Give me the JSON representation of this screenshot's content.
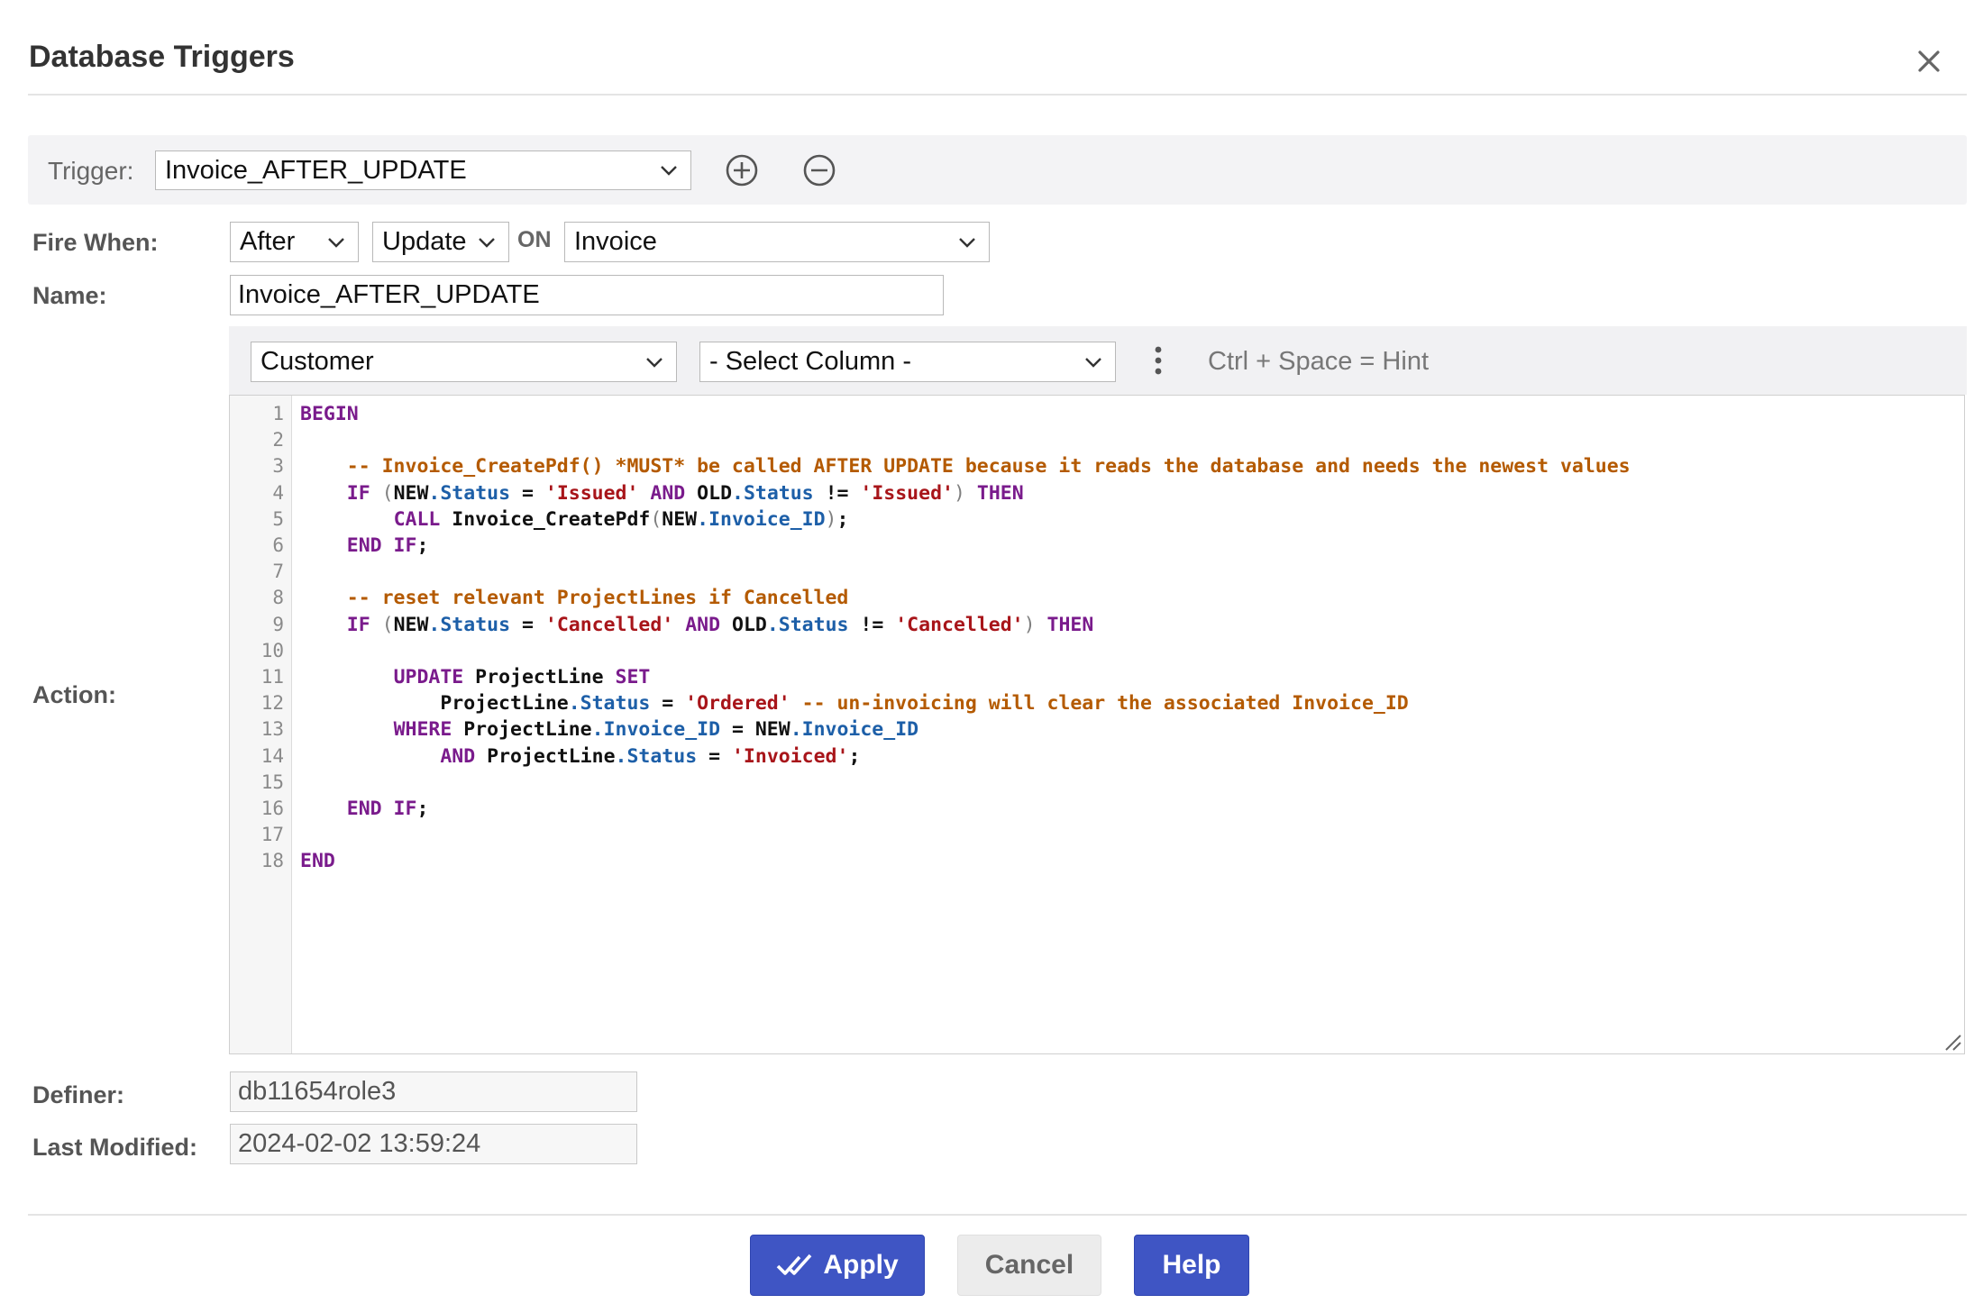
{
  "dialog": {
    "title": "Database Triggers"
  },
  "trigger": {
    "label": "Trigger:",
    "selected": "Invoice_AFTER_UPDATE"
  },
  "fire_when": {
    "label": "Fire When:",
    "timing": "After",
    "event": "Update",
    "on_label": "ON",
    "table": "Invoice"
  },
  "name": {
    "label": "Name:",
    "value": "Invoice_AFTER_UPDATE"
  },
  "action": {
    "label": "Action:",
    "table_select": "Customer",
    "column_select": "- Select Column -",
    "hint": "Ctrl + Space = Hint",
    "line_numbers": [
      "1",
      "2",
      "3",
      "4",
      "5",
      "6",
      "7",
      "8",
      "9",
      "10",
      "11",
      "12",
      "13",
      "14",
      "15",
      "16",
      "17",
      "18"
    ],
    "code_lines": [
      [
        {
          "t": "kw",
          "v": "BEGIN"
        }
      ],
      [],
      [
        {
          "t": "pl",
          "v": "    "
        },
        {
          "t": "cm",
          "v": "-- Invoice_CreatePdf() *MUST* be called AFTER UPDATE because it reads the database and needs the newest values"
        }
      ],
      [
        {
          "t": "pl",
          "v": "    "
        },
        {
          "t": "kw",
          "v": "IF"
        },
        {
          "t": "pl",
          "v": " "
        },
        {
          "t": "pn",
          "v": "("
        },
        {
          "t": "pl",
          "v": "NEW"
        },
        {
          "t": "fd",
          "v": ".Status"
        },
        {
          "t": "pl",
          "v": " = "
        },
        {
          "t": "st",
          "v": "'Issued'"
        },
        {
          "t": "pl",
          "v": " "
        },
        {
          "t": "kw",
          "v": "AND"
        },
        {
          "t": "pl",
          "v": " OLD"
        },
        {
          "t": "fd",
          "v": ".Status"
        },
        {
          "t": "pl",
          "v": " != "
        },
        {
          "t": "st",
          "v": "'Issued'"
        },
        {
          "t": "pn",
          "v": ")"
        },
        {
          "t": "pl",
          "v": " "
        },
        {
          "t": "kw",
          "v": "THEN"
        }
      ],
      [
        {
          "t": "pl",
          "v": "        "
        },
        {
          "t": "kw",
          "v": "CALL"
        },
        {
          "t": "pl",
          "v": " Invoice_CreatePdf"
        },
        {
          "t": "pn",
          "v": "("
        },
        {
          "t": "pl",
          "v": "NEW"
        },
        {
          "t": "fd",
          "v": ".Invoice_ID"
        },
        {
          "t": "pn",
          "v": ")"
        },
        {
          "t": "pl",
          "v": ";"
        }
      ],
      [
        {
          "t": "pl",
          "v": "    "
        },
        {
          "t": "kw",
          "v": "END IF"
        },
        {
          "t": "pl",
          "v": ";"
        }
      ],
      [],
      [
        {
          "t": "pl",
          "v": "    "
        },
        {
          "t": "cm",
          "v": "-- reset relevant ProjectLines if Cancelled"
        }
      ],
      [
        {
          "t": "pl",
          "v": "    "
        },
        {
          "t": "kw",
          "v": "IF"
        },
        {
          "t": "pl",
          "v": " "
        },
        {
          "t": "pn",
          "v": "("
        },
        {
          "t": "pl",
          "v": "NEW"
        },
        {
          "t": "fd",
          "v": ".Status"
        },
        {
          "t": "pl",
          "v": " = "
        },
        {
          "t": "st",
          "v": "'Cancelled'"
        },
        {
          "t": "pl",
          "v": " "
        },
        {
          "t": "kw",
          "v": "AND"
        },
        {
          "t": "pl",
          "v": " OLD"
        },
        {
          "t": "fd",
          "v": ".Status"
        },
        {
          "t": "pl",
          "v": " != "
        },
        {
          "t": "st",
          "v": "'Cancelled'"
        },
        {
          "t": "pn",
          "v": ")"
        },
        {
          "t": "pl",
          "v": " "
        },
        {
          "t": "kw",
          "v": "THEN"
        }
      ],
      [],
      [
        {
          "t": "pl",
          "v": "        "
        },
        {
          "t": "kw",
          "v": "UPDATE"
        },
        {
          "t": "pl",
          "v": " ProjectLine "
        },
        {
          "t": "kw",
          "v": "SET"
        }
      ],
      [
        {
          "t": "pl",
          "v": "            ProjectLine"
        },
        {
          "t": "fd",
          "v": ".Status"
        },
        {
          "t": "pl",
          "v": " = "
        },
        {
          "t": "st",
          "v": "'Ordered'"
        },
        {
          "t": "pl",
          "v": " "
        },
        {
          "t": "cm",
          "v": "-- un-invoicing will clear the associated Invoice_ID"
        }
      ],
      [
        {
          "t": "pl",
          "v": "        "
        },
        {
          "t": "kw",
          "v": "WHERE"
        },
        {
          "t": "pl",
          "v": " ProjectLine"
        },
        {
          "t": "fd",
          "v": ".Invoice_ID"
        },
        {
          "t": "pl",
          "v": " = NEW"
        },
        {
          "t": "fd",
          "v": ".Invoice_ID"
        }
      ],
      [
        {
          "t": "pl",
          "v": "            "
        },
        {
          "t": "kw",
          "v": "AND"
        },
        {
          "t": "pl",
          "v": " ProjectLine"
        },
        {
          "t": "fd",
          "v": ".Status"
        },
        {
          "t": "pl",
          "v": " = "
        },
        {
          "t": "st",
          "v": "'Invoiced'"
        },
        {
          "t": "pl",
          "v": ";"
        }
      ],
      [],
      [
        {
          "t": "pl",
          "v": "    "
        },
        {
          "t": "kw",
          "v": "END IF"
        },
        {
          "t": "pl",
          "v": ";"
        }
      ],
      [],
      [
        {
          "t": "kw",
          "v": "END"
        }
      ]
    ]
  },
  "definer": {
    "label": "Definer:",
    "value": "db11654role3"
  },
  "last_modified": {
    "label": "Last Modified:",
    "value": "2024-02-02 13:59:24"
  },
  "buttons": {
    "apply": "Apply",
    "cancel": "Cancel",
    "help": "Help"
  },
  "colors": {
    "primary": "#3f55c4",
    "keyword": "#7a1b8c",
    "comment": "#b45a00",
    "string": "#a8151a",
    "field": "#1d5fa8"
  }
}
